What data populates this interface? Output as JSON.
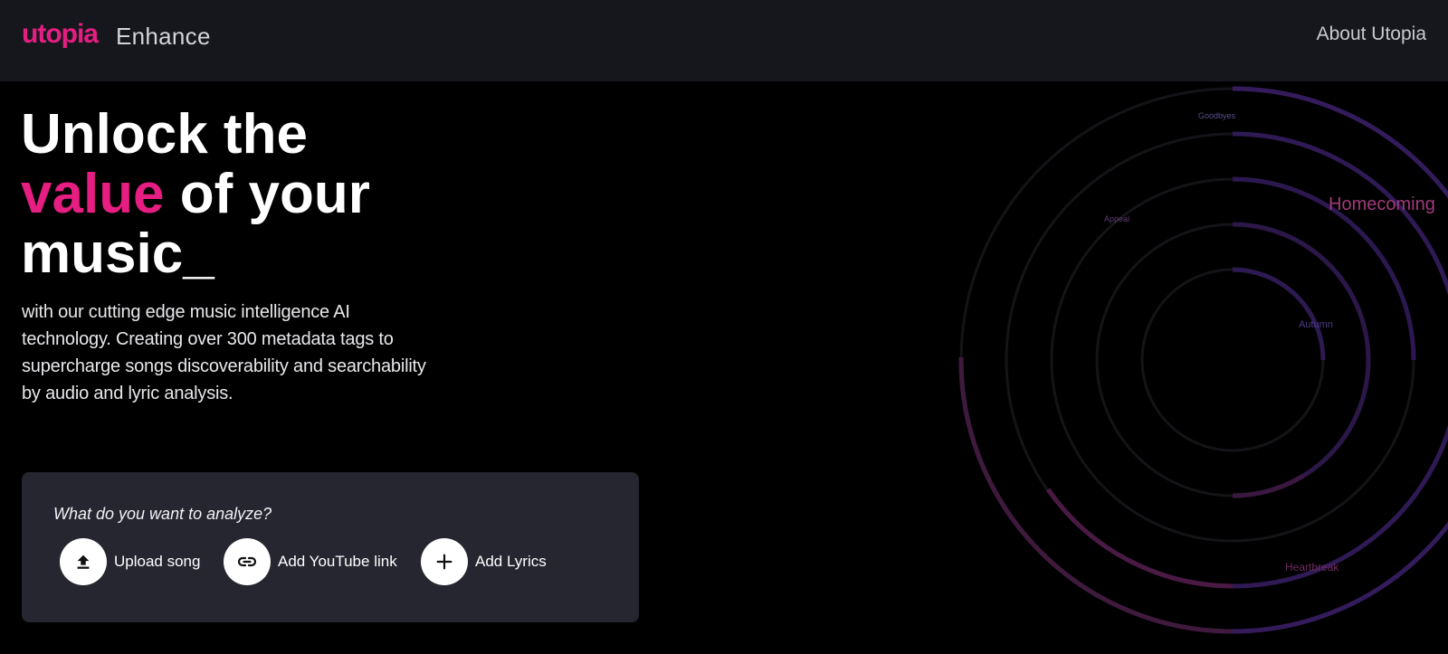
{
  "header": {
    "logo_text": "utopia",
    "product": "Enhance",
    "nav_about": "About Utopia"
  },
  "hero": {
    "title_line1": "Unlock the",
    "title_accent": "value",
    "title_line2_rest": " of your",
    "title_line3": "music_",
    "description": "with our cutting edge music intelligence AI technology. Creating over 300 metadata tags to supercharge songs discoverability and searchability by audio and lyric analysis."
  },
  "analyze": {
    "question": "What do you want to analyze?",
    "actions": [
      {
        "label": "Upload song",
        "icon": "upload-icon"
      },
      {
        "label": "Add YouTube link",
        "icon": "link-icon"
      },
      {
        "label": "Add Lyrics",
        "icon": "plus-icon"
      }
    ]
  },
  "visualization": {
    "tags": [
      "Goodbyes",
      "Homecoming",
      "Appeal",
      "Autumn",
      "Heartbreak"
    ]
  },
  "colors": {
    "accent": "#e61e82",
    "header_bg": "#16171d",
    "panel_bg": "#252630",
    "ring_purple": "#3a1f6e",
    "ring_magenta": "#5a1a44"
  }
}
